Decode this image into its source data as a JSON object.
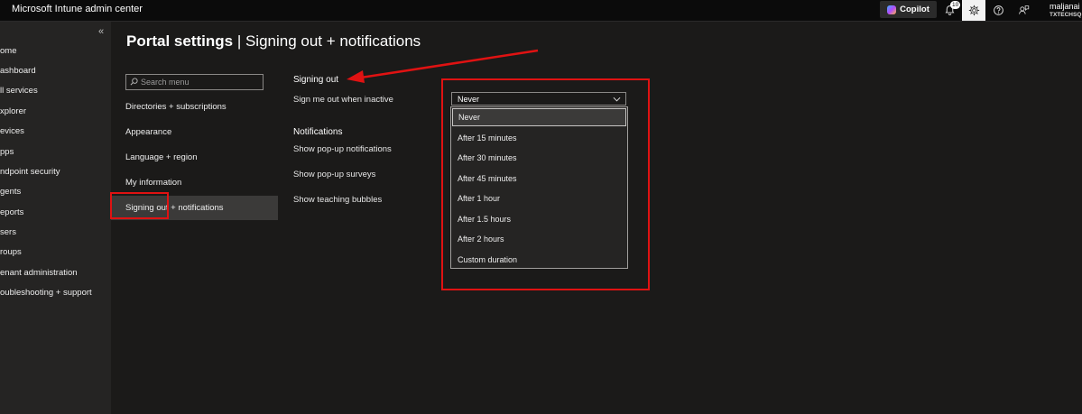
{
  "app_title": "Microsoft Intune admin center",
  "topbar": {
    "copilot_label": "Copilot",
    "notification_count": "10",
    "user_name": "maljanai",
    "user_tenant": "TXTECHSQ"
  },
  "icons": {
    "notifications": "bell-icon",
    "settings": "gear-icon",
    "help": "help-icon",
    "feedback": "feedback-icon",
    "search": "search-icon",
    "dropdown": "chevron-down-icon",
    "collapse": "double-chevron-left-icon"
  },
  "colors": {
    "annotation_red": "#e01212",
    "background": "#1b1a19",
    "nav_background": "#252423"
  },
  "left_nav": {
    "collapse_glyph": "«",
    "items": [
      {
        "label": "ome"
      },
      {
        "label": "ashboard"
      },
      {
        "label": "ll services"
      },
      {
        "label": "xplorer"
      },
      {
        "label": "evices"
      },
      {
        "label": "pps"
      },
      {
        "label": "ndpoint security"
      },
      {
        "label": "gents"
      },
      {
        "label": "eports"
      },
      {
        "label": "sers"
      },
      {
        "label": "roups"
      },
      {
        "label": "enant administration"
      },
      {
        "label": "oubleshooting + support"
      }
    ]
  },
  "page": {
    "title_bold": "Portal settings",
    "title_separator": " | ",
    "title_rest": "Signing out + notifications"
  },
  "settings_menu": {
    "search_placeholder": "Search menu",
    "items": [
      {
        "label": "Directories + subscriptions"
      },
      {
        "label": "Appearance"
      },
      {
        "label": "Language + region"
      },
      {
        "label": "My information"
      },
      {
        "label": "Signing out + notifications",
        "active": true
      }
    ]
  },
  "signing_out": {
    "heading": "Signing out",
    "inactive_label": "Sign me out when inactive",
    "selected_value": "Never",
    "options": [
      "Never",
      "After 15 minutes",
      "After 30 minutes",
      "After 45 minutes",
      "After 1 hour",
      "After 1.5 hours",
      "After 2 hours",
      "Custom duration"
    ]
  },
  "notifications": {
    "heading": "Notifications",
    "popup_notifications_label": "Show pop-up notifications",
    "popup_surveys_label": "Show pop-up surveys",
    "teaching_bubbles_label": "Show teaching bubbles"
  }
}
